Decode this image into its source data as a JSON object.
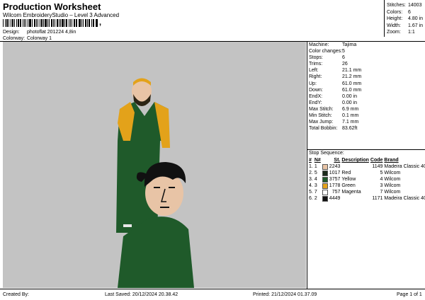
{
  "header": {
    "title": "Production Worksheet",
    "subtitle": "Wilcom EmbroideryStudio – Level 3 Advanced",
    "barcode_suffix": ","
  },
  "design": {
    "design_label": "Design:",
    "design_value": "photoflat 201224 4,8in",
    "colorway_label": "Colorway:",
    "colorway_value": "Colorway 1"
  },
  "stats": [
    {
      "label": "Stitches:",
      "value": "14003"
    },
    {
      "label": "Colors:",
      "value": "6"
    },
    {
      "label": "Height:",
      "value": "4.80 in"
    },
    {
      "label": "Width:",
      "value": "1.67 in"
    },
    {
      "label": "Zoom:",
      "value": "1:1"
    }
  ],
  "machine_info": [
    {
      "label": "Machine:",
      "value": "Tajima"
    },
    {
      "label": "Color changes:",
      "value": "5"
    },
    {
      "label": "Stops:",
      "value": "6"
    },
    {
      "label": "Trims:",
      "value": "26"
    },
    {
      "label": "Left:",
      "value": "21.1 mm"
    },
    {
      "label": "Right:",
      "value": "21.2 mm"
    },
    {
      "label": "Up:",
      "value": "61.0 mm"
    },
    {
      "label": "Down:",
      "value": "61.0 mm"
    },
    {
      "label": "EndX:",
      "value": "0.00 in"
    },
    {
      "label": "EndY:",
      "value": "0.00 in"
    },
    {
      "label": "Max Stitch:",
      "value": "6.9 mm"
    },
    {
      "label": "Min Stitch:",
      "value": "0.1 mm"
    },
    {
      "label": "Max Jump:",
      "value": "7.1 mm"
    },
    {
      "label": "Total Bobbin:",
      "value": "83.62ft"
    }
  ],
  "stop_sequence": {
    "title": "Stop Sequence:",
    "headers": {
      "num": "#",
      "n": "N#",
      "st": "St.",
      "desc": "Description",
      "code": "Code",
      "brand": "Brand"
    },
    "rows": [
      {
        "num": "1.",
        "n": "1",
        "color": "#e8c4a6",
        "st": "2243",
        "desc": "",
        "code": "1149",
        "brand": "Madeira Classic 40"
      },
      {
        "num": "2.",
        "n": "5",
        "color": "#1b2a1b",
        "st": "1017",
        "desc": "Red",
        "code": "5",
        "brand": "Wilcom"
      },
      {
        "num": "3.",
        "n": "4",
        "color": "#1f5a2a",
        "st": "3757",
        "desc": "Yellow",
        "code": "4",
        "brand": "Wilcom"
      },
      {
        "num": "4.",
        "n": "3",
        "color": "#e3a21a",
        "st": "1778",
        "desc": "Green",
        "code": "3",
        "brand": "Wilcom"
      },
      {
        "num": "5.",
        "n": "7",
        "color": "#ffffff",
        "st": "757",
        "desc": "Magenta",
        "code": "7",
        "brand": "Wilcom"
      },
      {
        "num": "6.",
        "n": "2",
        "color": "#111111",
        "st": "4449",
        "desc": "",
        "code": "1171",
        "brand": "Madeira Classic 40"
      }
    ]
  },
  "footer": {
    "created_by": "Created By:",
    "last_saved": "Last Saved: 20/12/2024 20.38.42",
    "printed": "Printed: 21/12/2024 01.37.09",
    "page": "Page 1 of 1"
  },
  "colors": {
    "canvas_bg": "#c3c3c3",
    "jacket_green": "#1f5a2a",
    "jacket_yellow": "#e3a21a",
    "skin": "#e8c4a6",
    "hair": "#111111"
  }
}
